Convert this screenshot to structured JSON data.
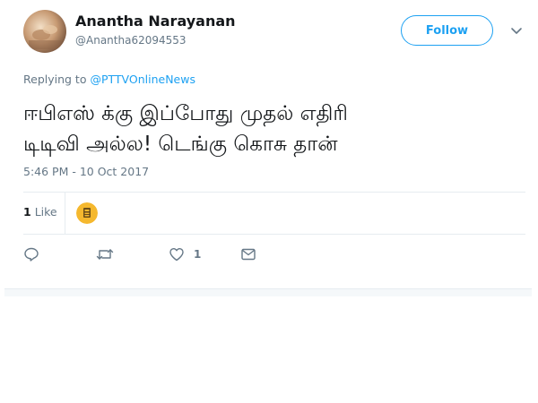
{
  "user": {
    "display_name": "Anantha Narayanan",
    "handle": "@Anantha62094553",
    "avatar_icon": "user-avatar-photo"
  },
  "follow_button": {
    "label": "Follow"
  },
  "reply_context": {
    "prefix": "Replying to",
    "mention": "@PTTVOnlineNews"
  },
  "tweet": {
    "lines": [
      "ஈபிஎஸ் க்கு இப்போது முதல் எதிரி",
      "டிடிவி அல்ல! டெங்கு கொசு தான்"
    ],
    "timestamp": "5:46 PM - 10 Oct 2017"
  },
  "stats": {
    "like_count": "1",
    "like_label": "Like"
  },
  "actions": {
    "reply_icon": "reply-icon",
    "retweet_icon": "retweet-icon",
    "like_icon": "heart-icon",
    "like_count": "1",
    "dm_icon": "envelope-icon"
  },
  "colors": {
    "accent": "#1da1f2",
    "text_primary": "#14171a",
    "text_secondary": "#657786",
    "divider": "#e6ecf0",
    "liker_avatar_bg": "#f5b82e"
  }
}
